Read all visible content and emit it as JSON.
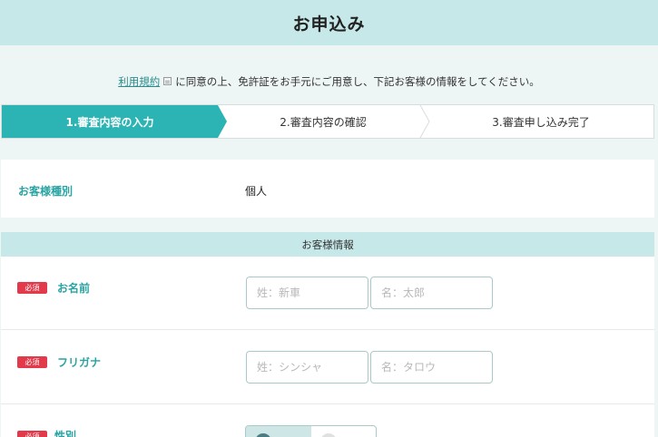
{
  "header": {
    "title": "お申込み"
  },
  "agreement": {
    "link_text": "利用規約",
    "text": "に同意の上、免許証をお手元にご用意し、下記お客様の情報をしてください。"
  },
  "steps": [
    {
      "label": "1.審査内容の入力"
    },
    {
      "label": "2.審査内容の確認"
    },
    {
      "label": "3.審査申し込み完了"
    }
  ],
  "customer_type": {
    "label": "お客様種別",
    "value": "個人"
  },
  "customer_info": {
    "section_title": "お客様情報",
    "required_badge": "必須",
    "name": {
      "label": "お名前",
      "last_placeholder": "姓：新車",
      "first_placeholder": "名：太郎"
    },
    "furigana": {
      "label": "フリガナ",
      "last_placeholder": "姓：シンシャ",
      "first_placeholder": "名：タロウ"
    },
    "gender": {
      "label": "性別"
    }
  },
  "colors": {
    "accent": "#2cb4b4",
    "header_bg": "#c7e8e8",
    "required": "#e23a4a"
  }
}
